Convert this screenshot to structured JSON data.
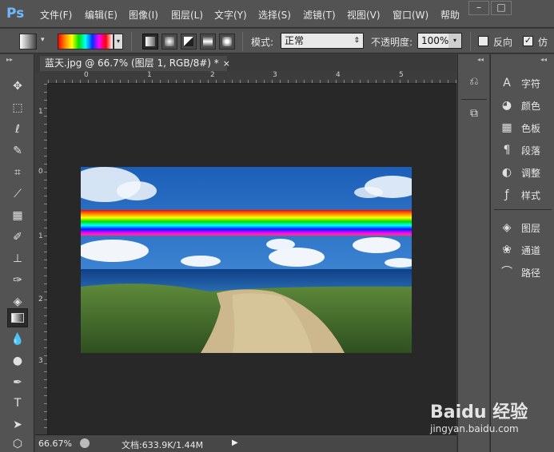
{
  "app": {
    "logo": "Ps"
  },
  "menu": [
    "文件(F)",
    "编辑(E)",
    "图像(I)",
    "图层(L)",
    "文字(Y)",
    "选择(S)",
    "滤镜(T)",
    "视图(V)",
    "窗口(W)",
    "帮助"
  ],
  "window_buttons": [
    "–",
    "□"
  ],
  "options": {
    "mode_label": "模式:",
    "mode_value": "正常",
    "opacity_label": "不透明度:",
    "opacity_value": "100%",
    "reverse_label": "反向",
    "dither_label": "仿"
  },
  "document": {
    "tab_title": "蓝天.jpg @ 66.7% (图层 1, RGB/8#) *",
    "tab_close": "×",
    "zoom": "66.67%",
    "doc_size": "文档:633.9K/1.44M",
    "h_ruler": [
      "0",
      "1",
      "2",
      "3",
      "4",
      "5"
    ],
    "v_ruler": [
      "1",
      "0",
      "1",
      "2",
      "3"
    ]
  },
  "panels": [
    {
      "label": "字符",
      "icon": "character-icon"
    },
    {
      "label": "颜色",
      "icon": "color-palette-icon"
    },
    {
      "label": "色板",
      "icon": "swatches-icon"
    },
    {
      "label": "段落",
      "icon": "paragraph-icon"
    },
    {
      "label": "调整",
      "icon": "adjustments-icon"
    },
    {
      "label": "样式",
      "icon": "styles-icon"
    },
    {
      "label": "图层",
      "icon": "layers-icon"
    },
    {
      "label": "通道",
      "icon": "channels-icon"
    },
    {
      "label": "路径",
      "icon": "paths-icon"
    }
  ],
  "watermark": {
    "brand": "Baidu 经验",
    "url": "jingyan.baidu.com"
  },
  "colors": {
    "accent": "#6fb7ff",
    "panel": "#535353",
    "canvas": "#282828"
  }
}
